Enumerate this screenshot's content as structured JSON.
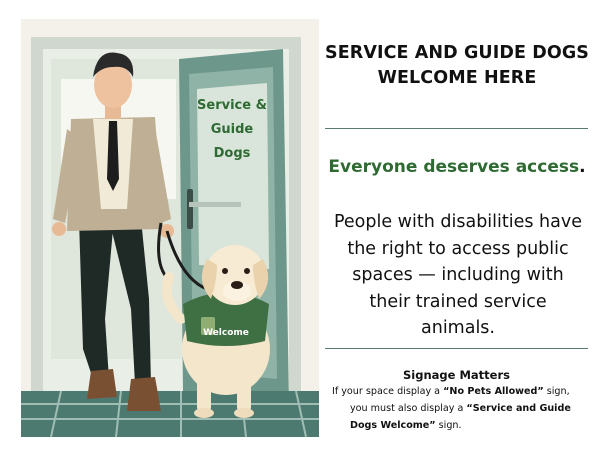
{
  "heading": {
    "line1": "SERVICE AND GUIDE DOGS",
    "line2": "WELCOME HERE"
  },
  "tagline": {
    "text": "Everyone deserves access",
    "punct": "."
  },
  "body": {
    "line1": "People with disabilities have",
    "line2": "the right to access public",
    "line3": "spaces — including with",
    "line4": "their trained service",
    "line5": "animals."
  },
  "signage": {
    "title": "Signage Matters",
    "p1_pre": "If your space  display a ",
    "p1_bold": "“No Pets Allowed”",
    "p1_post": " sign,",
    "p2_pre": "you must also display a ",
    "p2_bold": "“Service and Guide",
    "p3_bold": "Dogs Welcome”",
    "p3_post": " sign."
  },
  "illustration": {
    "door_sign": {
      "line1": "Service &",
      "line2": "Guide",
      "line3": "Dogs"
    },
    "vest_label": "Welcome"
  },
  "colors": {
    "accent_green": "#2f6a32",
    "rule": "#5b7b70",
    "door_teal": "#5b8a80"
  }
}
